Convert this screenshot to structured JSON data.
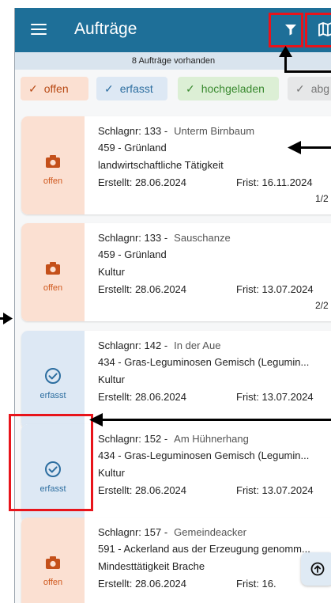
{
  "appbar": {
    "title": "Aufträge",
    "menu_icon": "hamburger-menu-icon",
    "filter_icon": "filter-icon",
    "map_icon": "map-icon"
  },
  "count_text": "8 Aufträge vorhanden",
  "filters": [
    {
      "label": "offen",
      "color": "#b84a15"
    },
    {
      "label": "erfasst",
      "color": "#2d6ea0"
    },
    {
      "label": "hochgeladen",
      "color": "#3a8a30"
    },
    {
      "label": "abg",
      "color": "#777777"
    }
  ],
  "orders": [
    {
      "status": "offen",
      "schlag": "Schlagnr: 133 -",
      "location": "Unterm Birnbaum",
      "nutzung": "459 - Grünland",
      "art": "landwirtschaftliche Tätigkeit",
      "erstellt": "Erstellt: 28.06.2024",
      "frist": "Frist: 16.11.2024",
      "page": "1/2"
    },
    {
      "status": "offen",
      "schlag": "Schlagnr: 133 -",
      "location": "Sauschanze",
      "nutzung": "459 - Grünland",
      "art": "Kultur",
      "erstellt": "Erstellt: 28.06.2024",
      "frist": "Frist: 13.07.2024",
      "page": "2/2"
    },
    {
      "status": "erfasst",
      "schlag": "Schlagnr: 142 -",
      "location": "In der Aue",
      "nutzung": "434 - Gras-Leguminosen Gemisch (Legumin...",
      "art": "Kultur",
      "erstellt": "Erstellt: 28.06.2024",
      "frist": "Frist: 13.07.2024",
      "page": ""
    },
    {
      "status": "erfasst",
      "schlag": "Schlagnr: 152 -",
      "location": "Am Hühnerhang",
      "nutzung": "434 - Gras-Leguminosen Gemisch (Legumin...",
      "art": "Kultur",
      "erstellt": "Erstellt: 28.06.2024",
      "frist": "Frist: 13.07.2024",
      "page": ""
    },
    {
      "status": "offen",
      "schlag": "Schlagnr: 157 -",
      "location": "Gemeindeacker",
      "nutzung": "591 - Ackerland aus der Erzeugung genomm...",
      "art": "Mindesttätigkeit Brache",
      "erstellt": "Erstellt: 28.06.2024",
      "frist": "Frist: 16.",
      "page": ""
    }
  ],
  "scroll_top_icon": "arrow-up-circle-icon",
  "colors": {
    "appbar": "#1e6f98",
    "offen": "#fbe0d2",
    "erfasst": "#dde8f4",
    "annotation": "#e8141b"
  }
}
